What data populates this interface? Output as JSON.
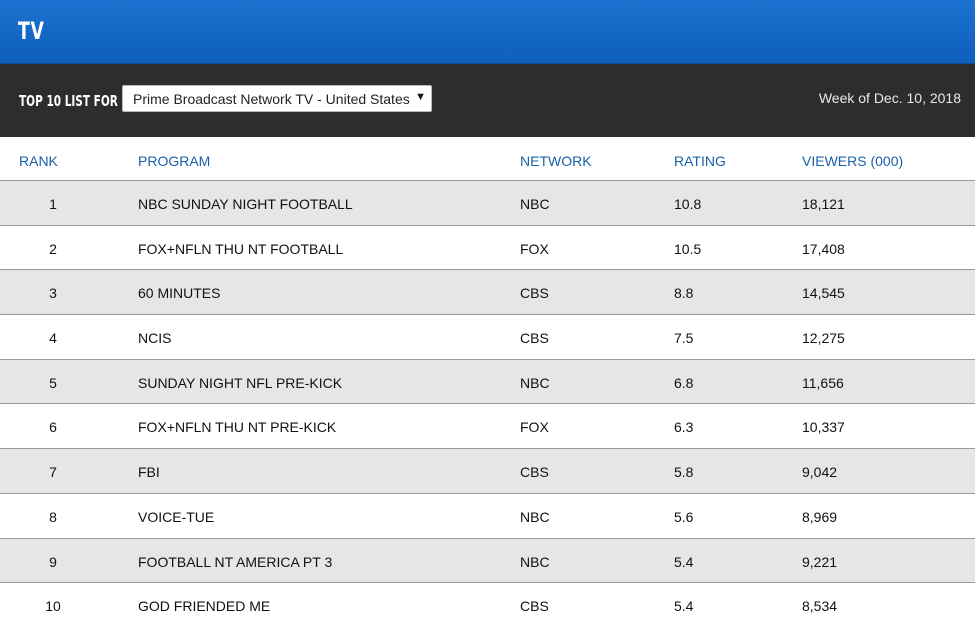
{
  "header": {
    "title": "TV"
  },
  "filter": {
    "label": "TOP 10 LIST FOR",
    "selected": "Prime Broadcast Network TV - United States",
    "week": "Week of Dec. 10, 2018"
  },
  "table": {
    "columns": {
      "rank": "RANK",
      "program": "PROGRAM",
      "network": "NETWORK",
      "rating": "RATING",
      "viewers": "VIEWERS (000)"
    },
    "rows": [
      {
        "rank": "1",
        "program": "NBC SUNDAY NIGHT FOOTBALL",
        "network": "NBC",
        "rating": "10.8",
        "viewers": "18,121"
      },
      {
        "rank": "2",
        "program": "FOX+NFLN THU NT FOOTBALL",
        "network": "FOX",
        "rating": "10.5",
        "viewers": "17,408"
      },
      {
        "rank": "3",
        "program": "60 MINUTES",
        "network": "CBS",
        "rating": "8.8",
        "viewers": "14,545"
      },
      {
        "rank": "4",
        "program": "NCIS",
        "network": "CBS",
        "rating": "7.5",
        "viewers": "12,275"
      },
      {
        "rank": "5",
        "program": "SUNDAY NIGHT NFL PRE-KICK",
        "network": "NBC",
        "rating": "6.8",
        "viewers": "11,656"
      },
      {
        "rank": "6",
        "program": "FOX+NFLN THU NT PRE-KICK",
        "network": "FOX",
        "rating": "6.3",
        "viewers": "10,337"
      },
      {
        "rank": "7",
        "program": "FBI",
        "network": "CBS",
        "rating": "5.8",
        "viewers": "9,042"
      },
      {
        "rank": "8",
        "program": "VOICE-TUE",
        "network": "NBC",
        "rating": "5.6",
        "viewers": "8,969"
      },
      {
        "rank": "9",
        "program": "FOOTBALL NT AMERICA PT 3",
        "network": "NBC",
        "rating": "5.4",
        "viewers": "9,221"
      },
      {
        "rank": "10",
        "program": "GOD FRIENDED ME",
        "network": "CBS",
        "rating": "5.4",
        "viewers": "8,534"
      }
    ]
  },
  "icons": {
    "select_arrow": "triangle-down-icon"
  },
  "colors": {
    "header_blue": "#1468c8",
    "filter_bar": "#2d2d2f",
    "column_header_text": "#1a5fa8",
    "row_stripe": "#e6e6e6"
  }
}
